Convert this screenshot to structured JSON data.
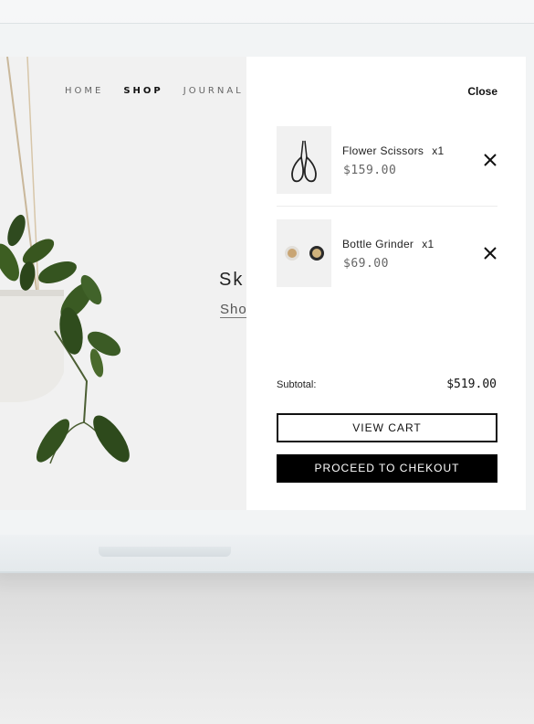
{
  "nav": {
    "items": [
      "HOME",
      "SHOP",
      "JOURNAL"
    ],
    "active": "SHOP"
  },
  "hero": {
    "title": "Sk",
    "link": "Sho"
  },
  "cart": {
    "close_label": "Close",
    "items": [
      {
        "name": "Flower Scissors",
        "qty": "x1",
        "price": "$159.00",
        "icon": "scissors-icon"
      },
      {
        "name": "Bottle Grinder",
        "qty": "x1",
        "price": "$69.00",
        "icon": "grinder-icon"
      }
    ],
    "subtotal_label": "Subtotal:",
    "subtotal_value": "$519.00",
    "view_cart_label": "VIEW CART",
    "checkout_label": "PROCEED TO CHEKOUT"
  },
  "colors": {
    "accent": "#000000",
    "background": "#f1f1f1",
    "panel": "#ffffff"
  }
}
